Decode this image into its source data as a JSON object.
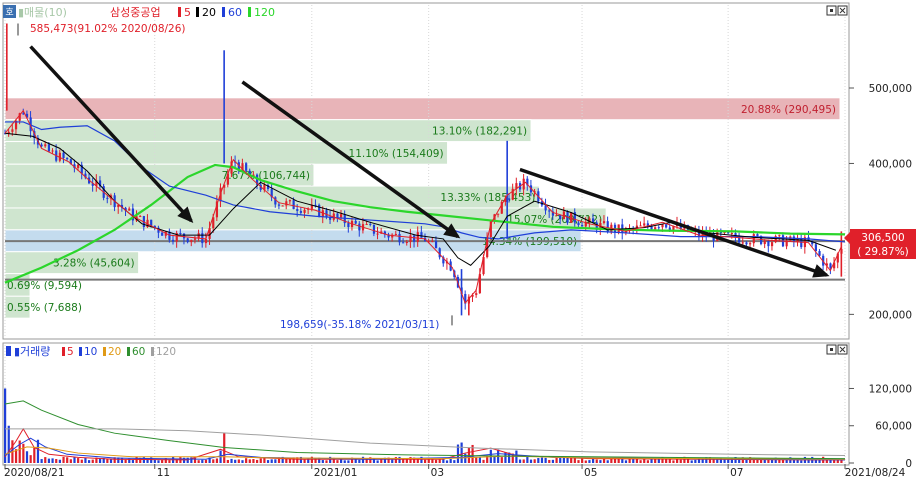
{
  "chart_data": [
    {
      "type": "candlestick",
      "panel": "price",
      "header": {
        "badge": "호",
        "volume_profile_label": "▮매물(10)",
        "title": "삼성중공업",
        "ma_legend": [
          {
            "label": "5",
            "color": "#e0202a"
          },
          {
            "label": "20",
            "color": "#000000"
          },
          {
            "label": "60",
            "color": "#1f3fd8"
          },
          {
            "label": "120",
            "color": "#2bd62b"
          }
        ]
      },
      "ylim": [
        170000,
        610000
      ],
      "y_ticks": [
        {
          "value": 500000,
          "label": "500,000"
        },
        {
          "value": 400000,
          "label": "400,000"
        },
        {
          "value": 200000,
          "label": "200,000"
        }
      ],
      "high_marker": {
        "price": 585473,
        "text": "585,473(91.02% 2020/08/26)"
      },
      "low_marker": {
        "price": 198659,
        "text": "198,659(-35.18% 2021/03/11)"
      },
      "last_price": {
        "price": 306500,
        "label": "306,500",
        "change": "( 29.87%)"
      },
      "horizontal_lines": [
        297000,
        246000
      ],
      "volume_profile_zones": [
        {
          "pct_text": "20.88% (290,495)",
          "color": "#e8b4b8",
          "price_top": 487000,
          "price_bottom": 458000,
          "bar_fraction": 1.0,
          "label_align": "right"
        },
        {
          "pct_text": "13.10% (182,291)",
          "color": "#cfe5cf",
          "price_top": 458000,
          "price_bottom": 429000,
          "bar_fraction": 0.63,
          "label_align": "right"
        },
        {
          "pct_text": "11.10% (154,409)",
          "color": "#cfe5cf",
          "price_top": 429000,
          "price_bottom": 399000,
          "bar_fraction": 0.53,
          "label_align": "right"
        },
        {
          "pct_text": "7.67% (106,744)",
          "color": "#cfe5cf",
          "price_top": 399000,
          "price_bottom": 370000,
          "bar_fraction": 0.37,
          "label_align": "right"
        },
        {
          "pct_text": "13.33% (185,453)",
          "color": "#cfe5cf",
          "price_top": 370000,
          "price_bottom": 341000,
          "bar_fraction": 0.64,
          "label_align": "right"
        },
        {
          "pct_text": "15.07% (209,712)",
          "color": "#cfe5cf",
          "price_top": 341000,
          "price_bottom": 312000,
          "bar_fraction": 0.72,
          "label_align": "right"
        },
        {
          "pct_text": "14.34% (199,510)",
          "color": "#c4dcee",
          "price_top": 312000,
          "price_bottom": 283000,
          "bar_fraction": 0.69,
          "label_align": "right"
        },
        {
          "pct_text": "3.28% (45,604)",
          "color": "#cfe5cf",
          "price_top": 283000,
          "price_bottom": 254000,
          "bar_fraction": 0.16,
          "label_align": "right"
        },
        {
          "pct_text": "0.69% (9,594)",
          "color": "#cfe5cf",
          "price_top": 254000,
          "price_bottom": 224000,
          "bar_fraction": 0.03,
          "label_align": "right"
        },
        {
          "pct_text": "0.55% (7,688)",
          "color": "#cfe5cf",
          "price_top": 224000,
          "price_bottom": 195000,
          "bar_fraction": 0.03,
          "label_align": "right"
        }
      ],
      "ma120": [
        [
          0,
          242000
        ],
        [
          20,
          262000
        ],
        [
          40,
          285000
        ],
        [
          60,
          312000
        ],
        [
          80,
          345000
        ],
        [
          100,
          382000
        ],
        [
          115,
          398000
        ],
        [
          125,
          395000
        ],
        [
          140,
          378000
        ],
        [
          160,
          363000
        ],
        [
          180,
          350000
        ],
        [
          200,
          342000
        ],
        [
          220,
          336000
        ],
        [
          240,
          331000
        ],
        [
          260,
          326000
        ],
        [
          280,
          321000
        ],
        [
          300,
          316000
        ],
        [
          330,
          313000
        ],
        [
          360,
          311000
        ],
        [
          400,
          310000
        ],
        [
          430,
          307000
        ],
        [
          460,
          306000
        ]
      ],
      "ma60": [
        [
          0,
          455000
        ],
        [
          10,
          455000
        ],
        [
          20,
          445000
        ],
        [
          30,
          448000
        ],
        [
          45,
          450000
        ],
        [
          60,
          430000
        ],
        [
          75,
          395000
        ],
        [
          90,
          370000
        ],
        [
          110,
          358000
        ],
        [
          125,
          345000
        ],
        [
          145,
          336000
        ],
        [
          170,
          330000
        ],
        [
          200,
          325000
        ],
        [
          230,
          320000
        ],
        [
          240,
          316000
        ],
        [
          250,
          308000
        ],
        [
          260,
          302000
        ],
        [
          270,
          300000
        ],
        [
          290,
          308000
        ],
        [
          310,
          312000
        ],
        [
          340,
          308000
        ],
        [
          370,
          303000
        ],
        [
          410,
          303000
        ],
        [
          440,
          300000
        ],
        [
          460,
          296000
        ]
      ],
      "ma20": [
        [
          0,
          440000
        ],
        [
          15,
          436000
        ],
        [
          30,
          420000
        ],
        [
          45,
          390000
        ],
        [
          60,
          350000
        ],
        [
          75,
          320000
        ],
        [
          95,
          305000
        ],
        [
          112,
          305000
        ],
        [
          125,
          340000
        ],
        [
          140,
          375000
        ],
        [
          160,
          350000
        ],
        [
          180,
          337000
        ],
        [
          200,
          322000
        ],
        [
          225,
          305000
        ],
        [
          240,
          300000
        ],
        [
          248,
          275000
        ],
        [
          255,
          265000
        ],
        [
          265,
          290000
        ],
        [
          275,
          330000
        ],
        [
          290,
          350000
        ],
        [
          310,
          335000
        ],
        [
          330,
          312000
        ],
        [
          350,
          315000
        ],
        [
          365,
          322000
        ],
        [
          385,
          308000
        ],
        [
          410,
          302000
        ],
        [
          440,
          298000
        ],
        [
          455,
          285000
        ]
      ],
      "ma5": [
        [
          0,
          440000
        ],
        [
          10,
          470000
        ],
        [
          20,
          420000
        ],
        [
          35,
          402000
        ],
        [
          45,
          380000
        ],
        [
          55,
          360000
        ],
        [
          70,
          330000
        ],
        [
          90,
          305000
        ],
        [
          110,
          300000
        ],
        [
          118,
          360000
        ],
        [
          125,
          405000
        ],
        [
          135,
          380000
        ],
        [
          150,
          348000
        ],
        [
          170,
          338000
        ],
        [
          190,
          320000
        ],
        [
          210,
          305000
        ],
        [
          230,
          300000
        ],
        [
          245,
          262000
        ],
        [
          252,
          215000
        ],
        [
          258,
          232000
        ],
        [
          266,
          320000
        ],
        [
          275,
          358000
        ],
        [
          285,
          375000
        ],
        [
          300,
          335000
        ],
        [
          320,
          320000
        ],
        [
          340,
          310000
        ],
        [
          360,
          322000
        ],
        [
          380,
          305000
        ],
        [
          400,
          302000
        ],
        [
          420,
          298000
        ],
        [
          440,
          295000
        ],
        [
          452,
          258000
        ],
        [
          458,
          290000
        ]
      ]
    },
    {
      "type": "bar",
      "panel": "volume",
      "header": {
        "title": "▮거래량",
        "legend": [
          {
            "label": "5",
            "color": "#e0202a"
          },
          {
            "label": "10",
            "color": "#1f3fd8"
          },
          {
            "label": "20",
            "color": "#e09a16"
          },
          {
            "label": "60",
            "color": "#2f8f2f"
          },
          {
            "label": "120",
            "color": "#a0a0a0"
          }
        ]
      },
      "ylim": [
        0,
        190000
      ],
      "y_ticks": [
        {
          "value": 120000,
          "label": "120,000"
        },
        {
          "value": 60000,
          "label": "60,000"
        },
        {
          "value": 0,
          "label": "0"
        }
      ],
      "ma_lines": [
        {
          "name": "5",
          "color": "#e0202a",
          "points": [
            [
              0,
              10000
            ],
            [
              6,
              35000
            ],
            [
              10,
              55000
            ],
            [
              16,
              25000
            ],
            [
              24,
              14000
            ],
            [
              40,
              9000
            ],
            [
              60,
              6000
            ],
            [
              100,
              5000
            ],
            [
              118,
              22000
            ],
            [
              128,
              10000
            ],
            [
              160,
              6000
            ],
            [
              240,
              6000
            ],
            [
              252,
              16000
            ],
            [
              266,
              24000
            ],
            [
              280,
              12000
            ],
            [
              320,
              7000
            ],
            [
              440,
              5000
            ],
            [
              460,
              5000
            ]
          ]
        },
        {
          "name": "10",
          "color": "#1f3fd8",
          "points": [
            [
              0,
              12000
            ],
            [
              8,
              30000
            ],
            [
              14,
              40000
            ],
            [
              22,
              26000
            ],
            [
              34,
              14000
            ],
            [
              60,
              8000
            ],
            [
              110,
              6000
            ],
            [
              122,
              14000
            ],
            [
              140,
              9000
            ],
            [
              200,
              6000
            ],
            [
              250,
              9000
            ],
            [
              270,
              15000
            ],
            [
              300,
              9000
            ],
            [
              460,
              5000
            ]
          ]
        },
        {
          "name": "20",
          "color": "#e09a16",
          "points": [
            [
              0,
              14000
            ],
            [
              12,
              26000
            ],
            [
              24,
              24000
            ],
            [
              40,
              16000
            ],
            [
              70,
              10000
            ],
            [
              120,
              10000
            ],
            [
              150,
              8000
            ],
            [
              240,
              7000
            ],
            [
              275,
              11000
            ],
            [
              320,
              8000
            ],
            [
              460,
              6000
            ]
          ]
        },
        {
          "name": "60",
          "color": "#2f8f2f",
          "points": [
            [
              0,
              95000
            ],
            [
              10,
              100000
            ],
            [
              20,
              85000
            ],
            [
              40,
              62000
            ],
            [
              60,
              48000
            ],
            [
              90,
              36000
            ],
            [
              120,
              25000
            ],
            [
              160,
              17000
            ],
            [
              220,
              13000
            ],
            [
              280,
              11000
            ],
            [
              360,
              9000
            ],
            [
              460,
              7000
            ]
          ]
        },
        {
          "name": "120",
          "color": "#a0a0a0",
          "points": [
            [
              0,
              55000
            ],
            [
              30,
              55000
            ],
            [
              60,
              55000
            ],
            [
              100,
              52000
            ],
            [
              140,
              45000
            ],
            [
              200,
              32000
            ],
            [
              260,
              24000
            ],
            [
              320,
              18000
            ],
            [
              400,
              14000
            ],
            [
              460,
              12000
            ]
          ]
        }
      ]
    }
  ],
  "x_axis": {
    "n_days": 460,
    "ticks": [
      {
        "day": 0,
        "label": "2020/08/21"
      },
      {
        "day": 82,
        "label": "11"
      },
      {
        "day": 168,
        "label": "2021/01"
      },
      {
        "day": 232,
        "label": "03"
      },
      {
        "day": 316,
        "label": "05"
      },
      {
        "day": 396,
        "label": "07"
      },
      {
        "day": 460,
        "label": "2021/08/24"
      }
    ]
  },
  "trend_arrows": [
    {
      "from": [
        14,
        555000
      ],
      "to": [
        102,
        324000
      ]
    },
    {
      "from": [
        130,
        508000
      ],
      "to": [
        248,
        303000
      ]
    },
    {
      "from": [
        282,
        392000
      ],
      "to": [
        450,
        252000
      ]
    }
  ]
}
